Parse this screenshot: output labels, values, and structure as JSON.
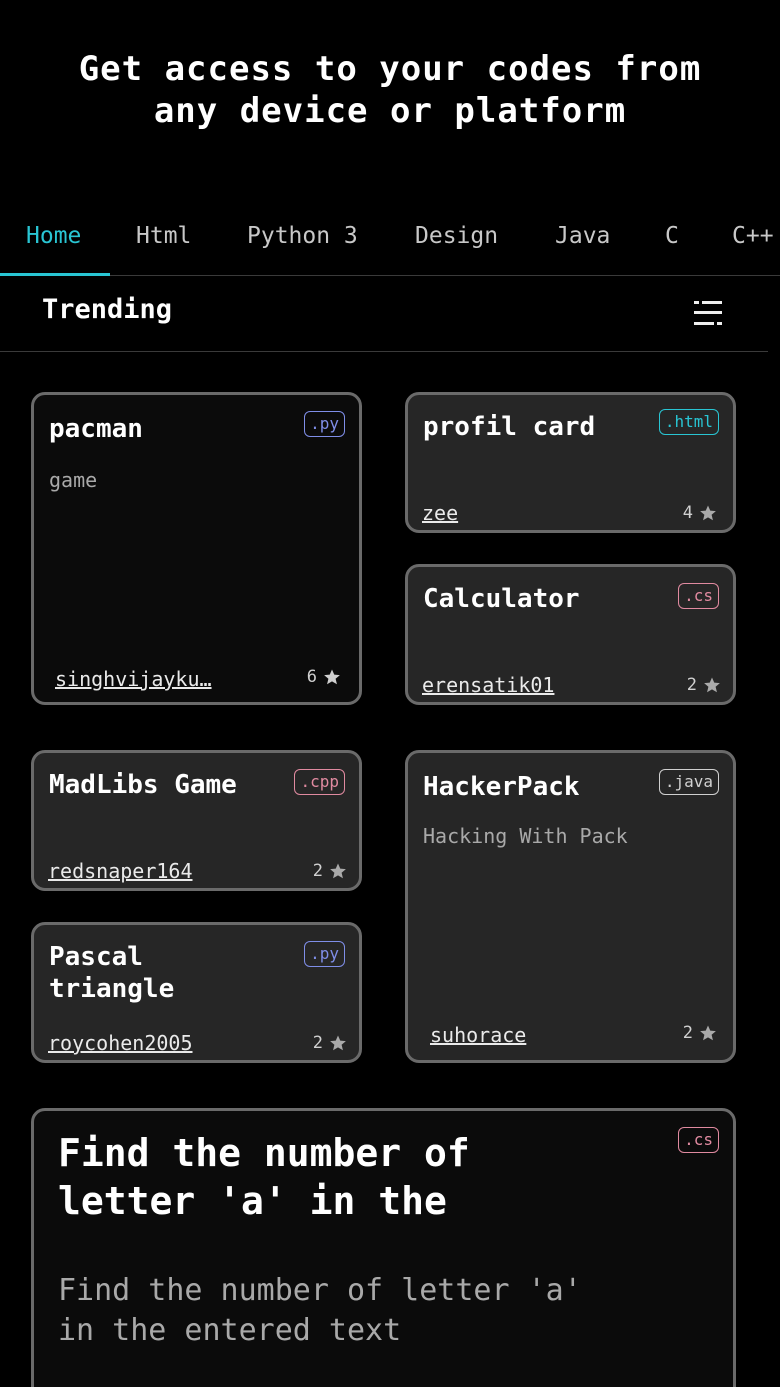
{
  "hero": {
    "line1": "Get access to your codes from",
    "line2": "any device or platform"
  },
  "tabs": [
    {
      "label": "Home",
      "active": true
    },
    {
      "label": "Html"
    },
    {
      "label": "Python 3"
    },
    {
      "label": "Design"
    },
    {
      "label": "Java"
    },
    {
      "label": "C"
    },
    {
      "label": "C++"
    }
  ],
  "section": {
    "title": "Trending"
  },
  "cards": [
    {
      "title": "pacman",
      "desc": "game",
      "lang": ".py",
      "author": "singhvijayku…",
      "stars": "6"
    },
    {
      "title": "profil card",
      "desc": "",
      "lang": ".html",
      "author": "zee",
      "stars": "4"
    },
    {
      "title": "Calculator",
      "desc": "",
      "lang": ".cs",
      "author": "erensatik01",
      "stars": "2"
    },
    {
      "title": "MadLibs Game",
      "desc": "",
      "lang": ".cpp",
      "author": "redsnaper164",
      "stars": "2"
    },
    {
      "title": "HackerPack",
      "desc": "Hacking With Pack",
      "lang": ".java",
      "author": "suhorace",
      "stars": "2"
    },
    {
      "title_line1": "Pascal",
      "title_line2": "triangle",
      "desc": "",
      "lang": ".py",
      "author": "roycohen2005",
      "stars": "2"
    },
    {
      "title_line1": "Find the number of",
      "title_line2": "letter 'a' in the",
      "desc_line1": "Find the number of letter 'a'",
      "desc_line2": "in the entered text",
      "lang": ".cs"
    }
  ],
  "colors": {
    "accent": "#29c5d3",
    "py": "#7f8ee8",
    "html": "#29c5d3",
    "cs": "#e08aa0",
    "cpp": "#e08aa0",
    "java": "#d0d0d0"
  }
}
